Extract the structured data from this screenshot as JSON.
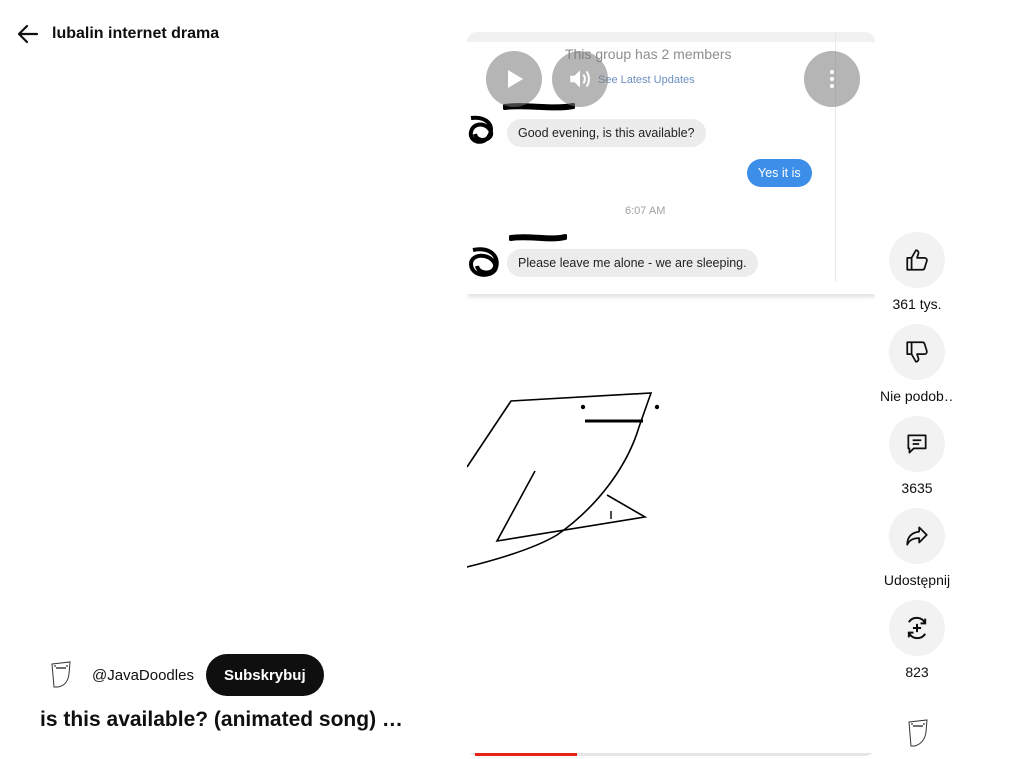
{
  "header": {
    "title": "lubalin internet drama",
    "back_icon": "arrow-left-icon"
  },
  "video": {
    "chat": {
      "group_info": "This group has 2 members",
      "latest_link": "See Latest Updates",
      "messages": [
        {
          "from": "other",
          "text": "Good evening, is this available?"
        },
        {
          "from": "me",
          "text": "Yes it is"
        },
        {
          "from": "other",
          "text": "Please leave me alone - we are sleeping."
        }
      ],
      "timestamp": "6:07 AM"
    },
    "controls": {
      "play_icon": "play-icon",
      "volume_icon": "volume-icon",
      "more_icon": "more-vert-icon"
    },
    "progress": 0.25,
    "colors": {
      "accent": "#e62117",
      "bubble_out": "#3d8ee8"
    }
  },
  "actions": [
    {
      "icon": "thumb-up-icon",
      "label": "361 tys."
    },
    {
      "icon": "thumb-down-icon",
      "label": "Nie podob…"
    },
    {
      "icon": "comment-icon",
      "label": "3635"
    },
    {
      "icon": "share-icon",
      "label": "Udostępnij"
    },
    {
      "icon": "remix-icon",
      "label": "823"
    }
  ],
  "channel": {
    "name": "@JavaDoodles",
    "subscribe_label": "Subskrybuj"
  },
  "title": "is this available? (animated song) …"
}
